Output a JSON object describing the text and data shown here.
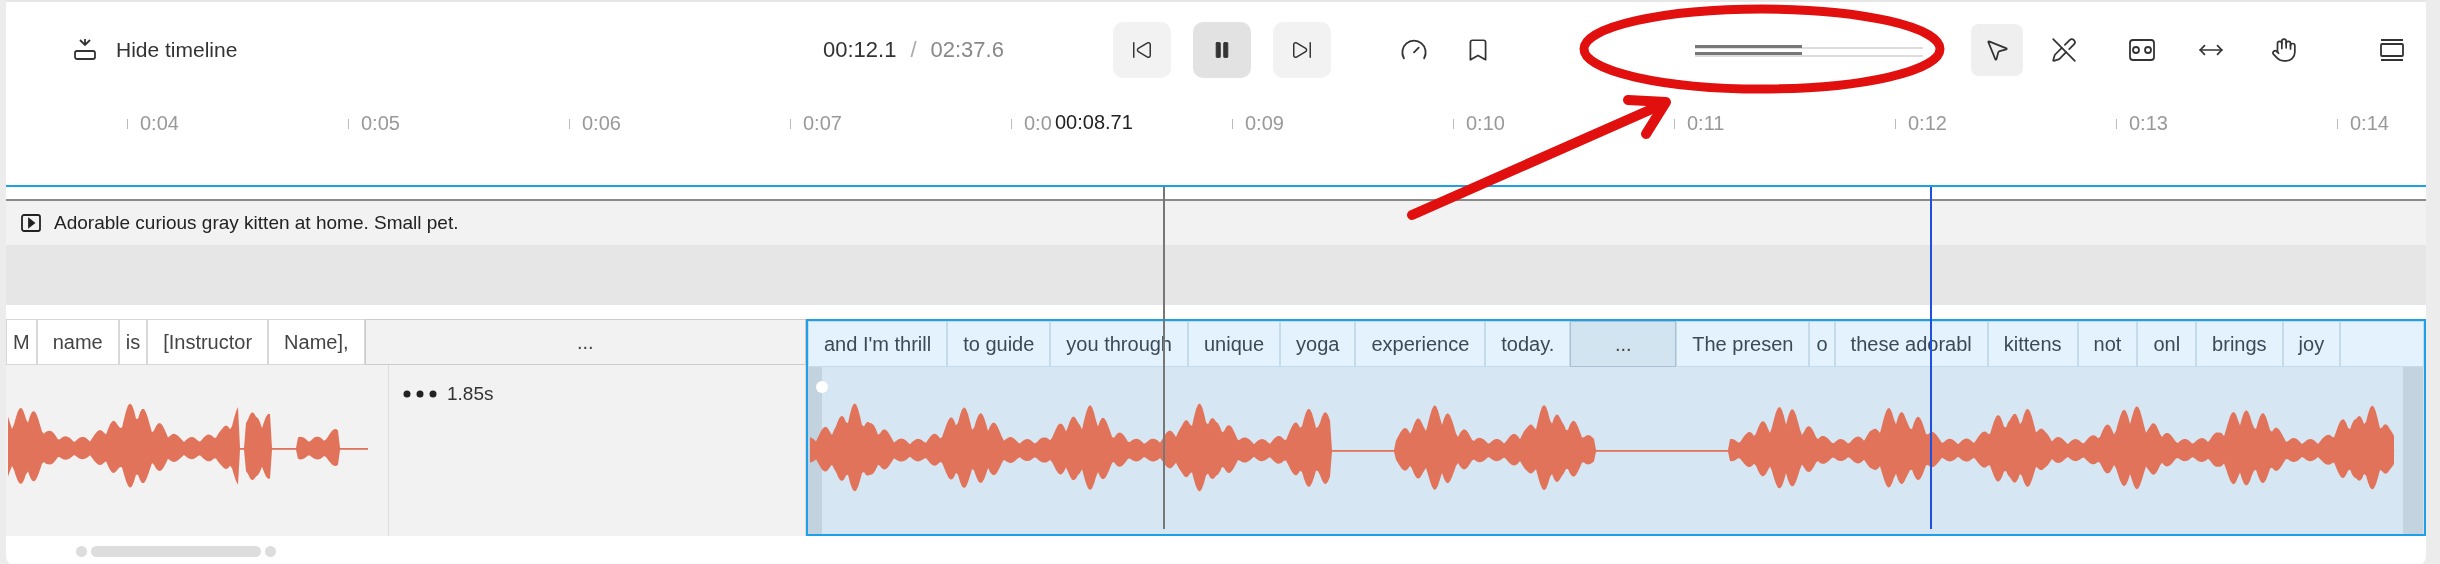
{
  "toolbar": {
    "hide_timeline": "Hide timeline",
    "current_time": "00:12.1",
    "separator": "/",
    "duration": "02:37.6",
    "playing": true,
    "zoom": {
      "level": 0.47
    },
    "tools": [
      {
        "kind": "select",
        "selected": true
      },
      {
        "kind": "cut",
        "selected": false
      },
      {
        "kind": "clip",
        "selected": false
      },
      {
        "kind": "stretch",
        "selected": false
      },
      {
        "kind": "pan",
        "selected": false
      }
    ]
  },
  "ruler": {
    "ticks": [
      "0:04",
      "0:05",
      "0:06",
      "0:07",
      "0:0",
      "0:09",
      "0:10",
      "0:11",
      "0:12",
      "0:13",
      "0:14"
    ],
    "playhead_label": "00:08.71"
  },
  "caption_track": {
    "text": "Adorable curious gray kitten at home. Small pet."
  },
  "word_track": {
    "words": [
      {
        "kind": "word",
        "text": "M",
        "selected": false
      },
      {
        "kind": "word",
        "text": "name",
        "selected": false
      },
      {
        "kind": "word",
        "text": "is",
        "selected": false
      },
      {
        "kind": "word",
        "text": "[Instructor",
        "selected": false
      },
      {
        "kind": "word",
        "text": "Name],",
        "selected": false
      },
      {
        "kind": "gap",
        "text": "...",
        "selected": false
      },
      {
        "kind": "word",
        "text": "and I'm thrill",
        "selected": true
      },
      {
        "kind": "word",
        "text": "to guide",
        "selected": true
      },
      {
        "kind": "word",
        "text": "you through",
        "selected": true
      },
      {
        "kind": "word",
        "text": "unique",
        "selected": true
      },
      {
        "kind": "word",
        "text": "yoga",
        "selected": true
      },
      {
        "kind": "word",
        "text": "experience",
        "selected": true
      },
      {
        "kind": "word",
        "text": "today.",
        "selected": true
      },
      {
        "kind": "gap",
        "text": "...",
        "selected": true
      },
      {
        "kind": "word",
        "text": "The presen",
        "selected": true
      },
      {
        "kind": "word",
        "text": "o",
        "selected": true
      },
      {
        "kind": "word",
        "text": "these adorabl",
        "selected": true
      },
      {
        "kind": "word",
        "text": "kittens",
        "selected": true
      },
      {
        "kind": "word",
        "text": "not",
        "selected": true
      },
      {
        "kind": "word",
        "text": "onl",
        "selected": true
      },
      {
        "kind": "word",
        "text": "brings",
        "selected": true
      },
      {
        "kind": "word",
        "text": "joy",
        "selected": true
      }
    ]
  },
  "audio_track": {
    "clips": [
      {
        "kind": "audio",
        "selected": false
      },
      {
        "kind": "pause",
        "label": "1.85s",
        "selected": false
      },
      {
        "kind": "audio",
        "selected": true
      }
    ]
  },
  "annotation": {
    "kind": "ellipse-arrow"
  }
}
